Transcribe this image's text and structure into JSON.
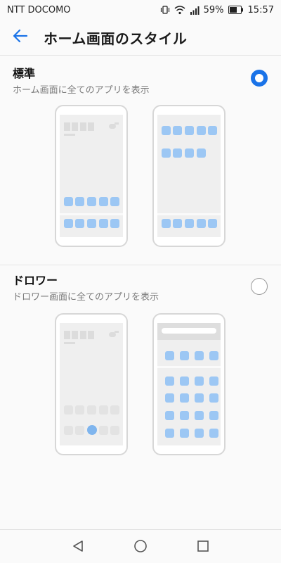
{
  "status_bar": {
    "carrier": "NTT DOCOMO",
    "battery": "59%",
    "time": "15:57",
    "icons": [
      "vibrate-icon",
      "wifi-icon",
      "signal-icon",
      "battery-icon"
    ]
  },
  "header": {
    "title": "ホーム画面のスタイル",
    "back_icon": "arrow-left-icon"
  },
  "options": [
    {
      "title": "標準",
      "description": "ホーム画面に全てのアプリを表示",
      "selected": true
    },
    {
      "title": "ドロワー",
      "description": "ドロワー画面に全てのアプリを表示",
      "selected": false
    }
  ],
  "nav_bar": {
    "buttons": [
      "back-triangle-icon",
      "home-circle-icon",
      "recents-square-icon"
    ]
  },
  "colors": {
    "accent": "#1a73e8",
    "app_icon": "#9cc7f4"
  }
}
